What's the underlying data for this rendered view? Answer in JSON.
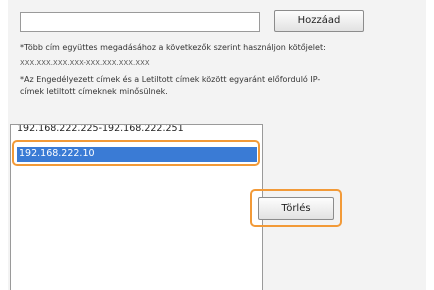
{
  "form": {
    "address_value": "",
    "add_button_label": "Hozzáad",
    "note1": "*Több cím együttes megadásához a következők szerint használjon kötőjelet:",
    "example_range": "XXX.XXX.XXX.XXX-XXX.XXX.XXX.XXX",
    "note2_line1": "*Az Engedélyezett címek és a Letiltott címek között egyaránt előforduló IP-",
    "note2_line2": "címek letiltott címeknek minősülnek."
  },
  "address_list": {
    "items": [
      "192.168.222.225-192.168.222.251",
      "192.168.222.10"
    ],
    "selected_index": 1
  },
  "actions": {
    "delete_button_label": "Törlés"
  },
  "colors": {
    "highlight": "#f29a38",
    "selection": "#3a7bd5",
    "panel_background": "#f3f3f3"
  }
}
